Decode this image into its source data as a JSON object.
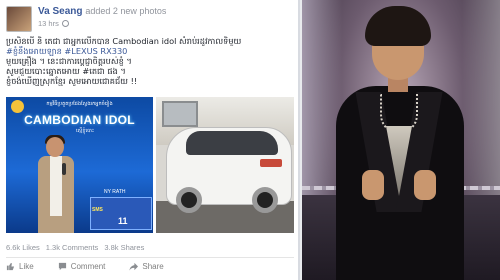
{
  "post": {
    "author": "Va Seang",
    "action": "added 2 new photos",
    "time": "13 hrs",
    "text_lines": [
      "ប្រសិនបើ និ តេជា ជាអ្នកលើកបាន Cambodian idol សំរាប់រដូវកាលទិមួយ",
      "#ខ្ញុំនឹងអោយឡាន #LEXUS RX330",
      "មួយគ្រឿង ។ នេះជាការប្តេជ្ញាចិត្តរបស់ខ្ញុំ ។",
      "សូមជួយបោះឆ្នោតអោយ #តេជា ផង ។",
      "ខ្ញុំចង់ឃើញស្រុកខ្មែរ សូមអោយជោគជ័យ !!"
    ],
    "photo1": {
      "banner_top": "កម្មវិធីប្រគួតប្រជែងស្វែងរកអ្នកចំរៀង",
      "title": "CAMBODIAN IDOL",
      "subtitle": "ស្មើខ្ញុំបោះ",
      "name_tag": "NY RATH",
      "vote_label": "SMS",
      "vote_number": "11"
    },
    "stats": {
      "likes": "6.6k Likes",
      "comments": "1.3k Comments",
      "shares": "3.8k Shares"
    },
    "actions": {
      "like": "Like",
      "comment": "Comment",
      "share": "Share"
    }
  },
  "colors": {
    "link_blue": "#3b5998",
    "meta_gray": "#90949c",
    "idol_blue": "#1d6ad6"
  },
  "icons": {
    "like": "thumbs-up-icon",
    "comment": "speech-bubble-icon",
    "share": "share-arrow-icon",
    "privacy": "globe-icon"
  }
}
